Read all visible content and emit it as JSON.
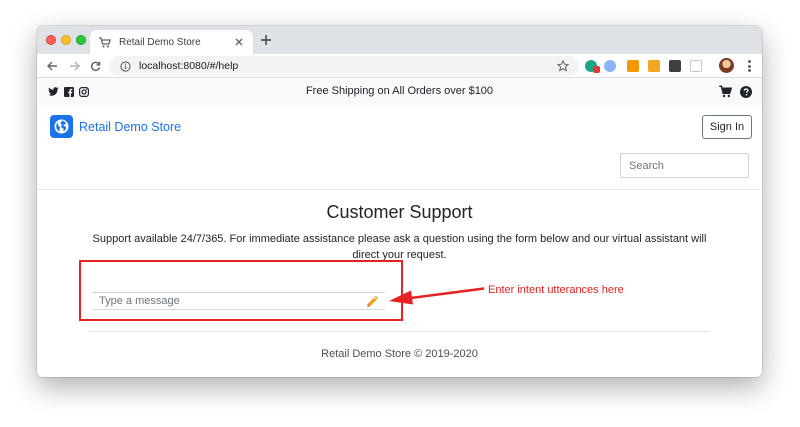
{
  "browser": {
    "tab_title": "Retail Demo Store",
    "url": "localhost:8080/#/help",
    "icons": [
      "cart-favicon",
      "close-icon",
      "plus-icon",
      "back-arrow-icon",
      "forward-arrow-icon",
      "reload-icon",
      "info-icon",
      "star-icon",
      "menu-icon"
    ]
  },
  "topbar": {
    "shipping_message": "Free Shipping on All Orders over $100",
    "social_icons": [
      "twitter-icon",
      "facebook-icon",
      "instagram-icon"
    ]
  },
  "header": {
    "brand_name": "Retail Demo Store",
    "signin_label": "Sign In",
    "search_placeholder": "Search"
  },
  "support": {
    "title": "Customer Support",
    "description": "Support available 24/7/365. For immediate assistance please ask a question using the form below and our virtual assistant will direct your request.",
    "message_placeholder": "Type a message"
  },
  "annotation": {
    "text": "Enter intent utterances here",
    "color": "#e62222"
  },
  "footer": {
    "copyright": "Retail Demo Store © 2019-2020"
  },
  "colors": {
    "brand": "#1a73e8",
    "topbar_bg": "#f8f9fa",
    "accent_pencil": "#f0a020"
  }
}
